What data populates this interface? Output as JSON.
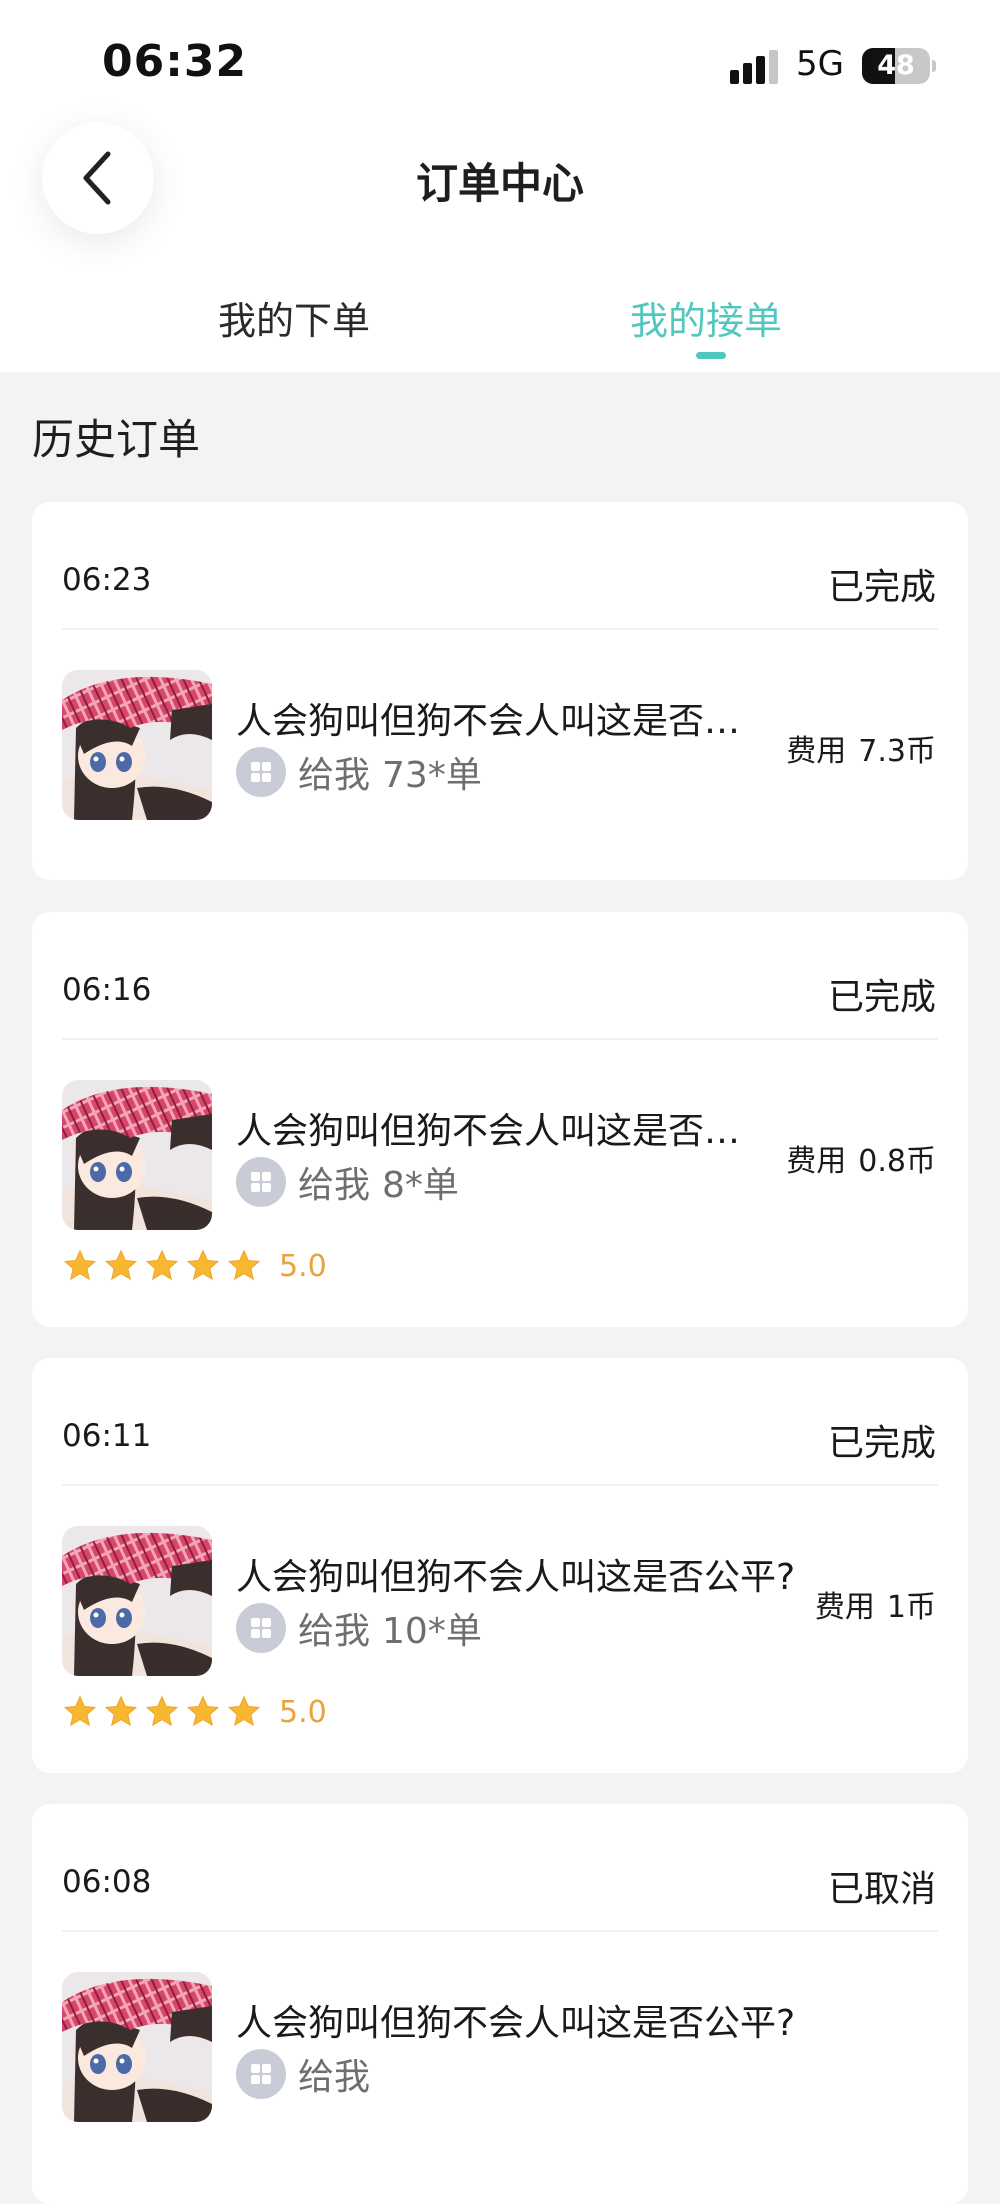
{
  "status_bar": {
    "time": "06:32",
    "network": "5G",
    "battery": "48",
    "battery_level": 0.48
  },
  "header": {
    "title": "订单中心",
    "back_icon": "chevron-left-icon"
  },
  "tabs": [
    {
      "label": "我的下单",
      "active": false
    },
    {
      "label": "我的接单",
      "active": true
    }
  ],
  "accent_color": "#52c7c0",
  "section_title": "历史订单",
  "orders": [
    {
      "time": "06:23",
      "status": "已完成",
      "name": "人会狗叫但狗不会人叫这是否…",
      "sub_label": "给我",
      "sub_count": "73*单",
      "fee_label": "费用",
      "fee_amount": "7.3币",
      "rating": null
    },
    {
      "time": "06:16",
      "status": "已完成",
      "name": "人会狗叫但狗不会人叫这是否…",
      "sub_label": "给我",
      "sub_count": "8*单",
      "fee_label": "费用",
      "fee_amount": "0.8币",
      "rating": "5.0"
    },
    {
      "time": "06:11",
      "status": "已完成",
      "name": "人会狗叫但狗不会人叫这是否公平?",
      "sub_label": "给我",
      "sub_count": "10*单",
      "fee_label": "费用",
      "fee_amount": "1币",
      "rating": "5.0"
    },
    {
      "time": "06:08",
      "status": "已取消",
      "name": "人会狗叫但狗不会人叫这是否公平?",
      "sub_label": "给我",
      "sub_count": "",
      "fee_label": "",
      "fee_amount": "",
      "rating": null
    }
  ]
}
